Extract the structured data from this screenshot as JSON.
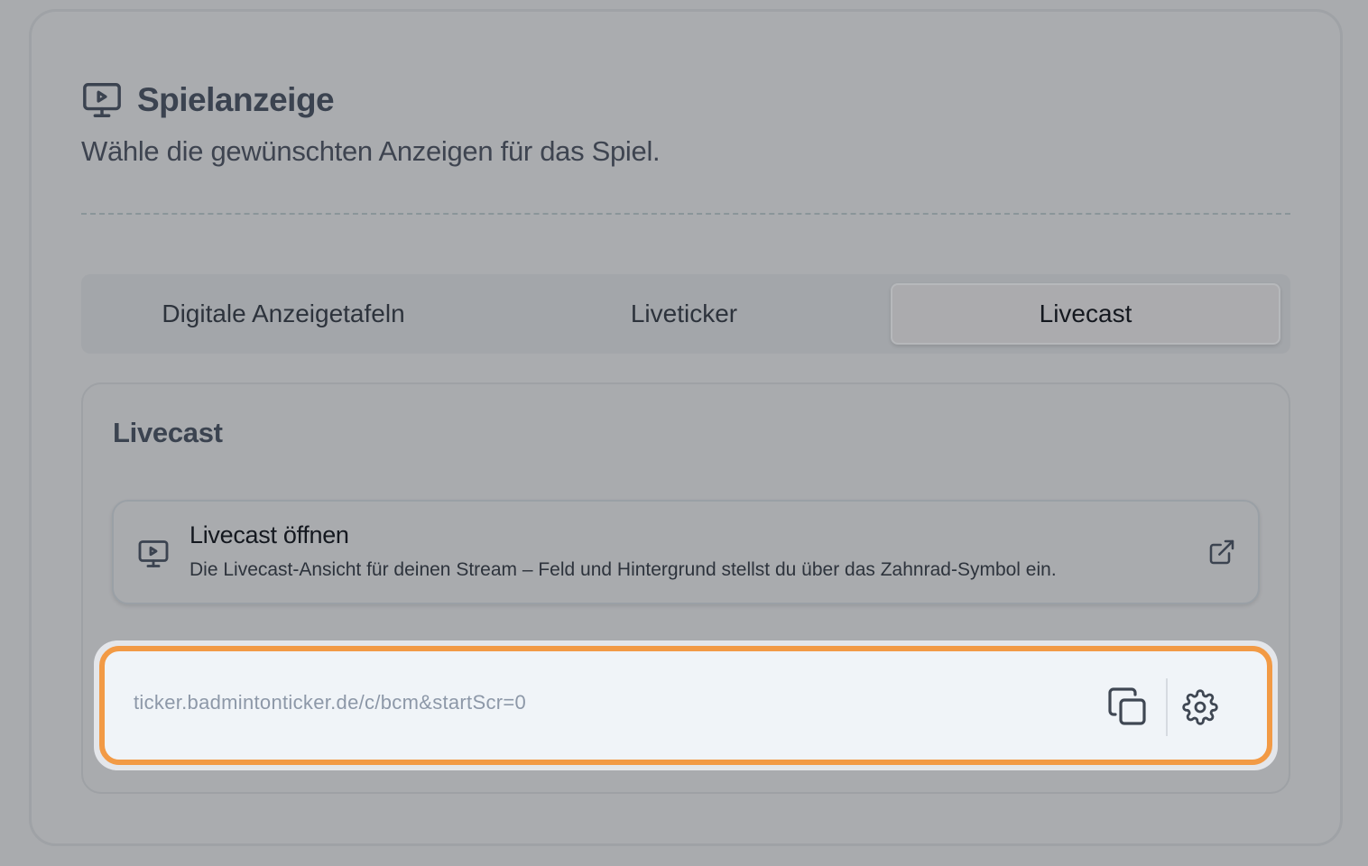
{
  "section": {
    "icon": "monitor-play-icon",
    "title": "Spielanzeige",
    "subtitle": "Wähle die gewünschten Anzeigen für das Spiel."
  },
  "tabs": [
    {
      "label": "Digitale Anzeigetafeln",
      "active": false
    },
    {
      "label": "Liveticker",
      "active": false
    },
    {
      "label": "Livecast",
      "active": true
    }
  ],
  "panel": {
    "title": "Livecast",
    "open_card": {
      "icon": "monitor-play-icon",
      "title": "Livecast öffnen",
      "description": "Die Livecast-Ansicht für deinen Stream – Feld und Hintergrund stellst du über das Zahnrad-Symbol ein.",
      "action_icon": "external-link-icon"
    },
    "url_field": {
      "value": "ticker.badmintonticker.de/c/bcm&startScr=0",
      "copy_icon": "copy-icon",
      "settings_icon": "gear-icon"
    }
  },
  "colors": {
    "highlight": "#f29a45",
    "heading": "#3b4350"
  }
}
